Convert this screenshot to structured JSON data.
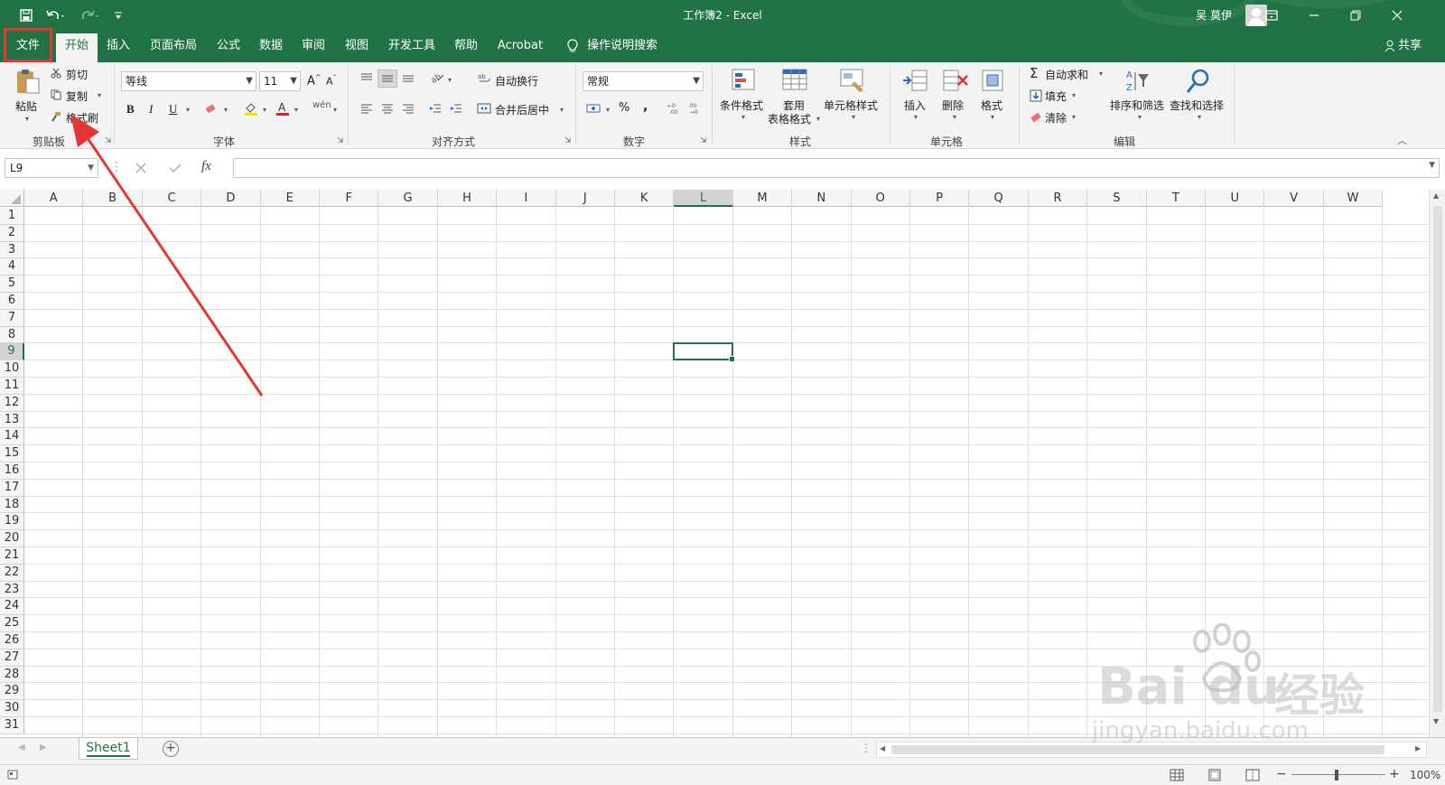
{
  "titlebar": {
    "title": "工作簿2 - Excel",
    "user": "吴 莫伊",
    "bg_color": "#217346"
  },
  "tabs": [
    "文件",
    "开始",
    "插入",
    "页面布局",
    "公式",
    "数据",
    "审阅",
    "视图",
    "开发工具",
    "帮助",
    "Acrobat"
  ],
  "active_tab": "开始",
  "tell_me": "操作说明搜索",
  "share": "共享",
  "ribbon": {
    "clipboard": {
      "paste": "粘贴",
      "cut": "剪切",
      "copy": "复制",
      "format_painter": "格式刷",
      "label": "剪贴板"
    },
    "font": {
      "name": "等线",
      "size": "11",
      "label": "字体",
      "bold": "B",
      "italic": "I",
      "underline": "U",
      "phonetic": "wén"
    },
    "alignment": {
      "wrap": "自动换行",
      "merge": "合并后居中",
      "label": "对齐方式"
    },
    "number": {
      "format": "常规",
      "percent": "%",
      "comma": ",",
      "label": "数字"
    },
    "styles": {
      "conditional": "条件格式",
      "table_1": "套用",
      "table_2": "表格格式",
      "cell_styles": "单元格样式",
      "label": "样式"
    },
    "cells": {
      "insert": "插入",
      "delete": "删除",
      "format": "格式",
      "label": "单元格"
    },
    "editing": {
      "autosum": "自动求和",
      "fill": "填充",
      "clear": "清除",
      "sort": "排序和筛选",
      "find": "查找和选择",
      "label": "编辑"
    }
  },
  "formula_bar": {
    "name_box": "L9",
    "fx": "fx",
    "value": ""
  },
  "grid": {
    "columns": [
      "A",
      "B",
      "C",
      "D",
      "E",
      "F",
      "G",
      "H",
      "I",
      "J",
      "K",
      "L",
      "M",
      "N",
      "O",
      "P",
      "Q",
      "R",
      "S",
      "T",
      "U",
      "V",
      "W"
    ],
    "rows": [
      "1",
      "2",
      "3",
      "4",
      "5",
      "6",
      "7",
      "8",
      "9",
      "10",
      "11",
      "12",
      "13",
      "14",
      "15",
      "16",
      "17",
      "18",
      "19",
      "20",
      "21",
      "22",
      "23",
      "24",
      "25",
      "26",
      "27",
      "28",
      "29",
      "30",
      "31"
    ],
    "selected_column": "L",
    "selected_row": "9"
  },
  "sheets": [
    "Sheet1"
  ],
  "status": {
    "zoom": "100%"
  },
  "watermark": {
    "brand": "Bai",
    "brand_2": "du",
    "cn": "经验",
    "url": "jingyan.baidu.com"
  }
}
